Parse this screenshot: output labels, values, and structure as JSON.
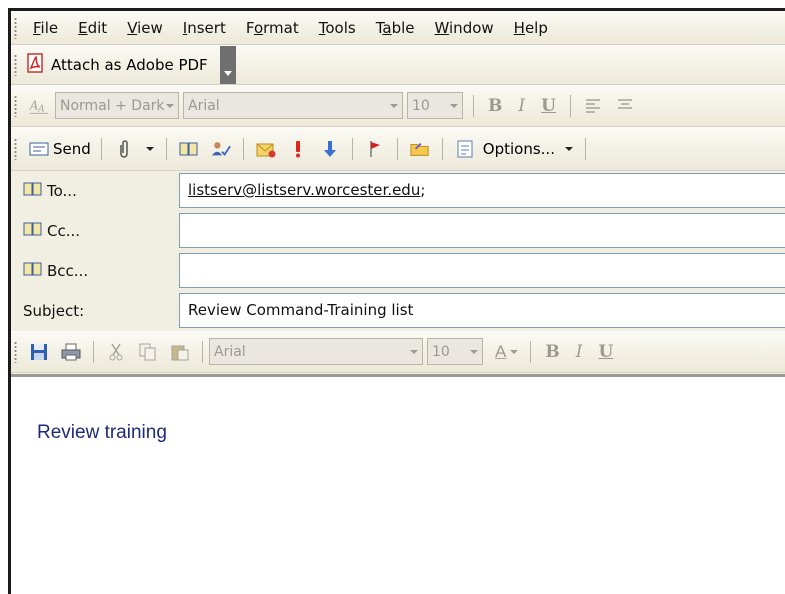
{
  "menu": {
    "items": [
      {
        "label": "File",
        "mnemonic_index": 0
      },
      {
        "label": "Edit",
        "mnemonic_index": 0
      },
      {
        "label": "View",
        "mnemonic_index": 0
      },
      {
        "label": "Insert",
        "mnemonic_index": 0
      },
      {
        "label": "Format",
        "mnemonic_index": 1
      },
      {
        "label": "Tools",
        "mnemonic_index": 0
      },
      {
        "label": "Table",
        "mnemonic_index": 1
      },
      {
        "label": "Window",
        "mnemonic_index": 0
      },
      {
        "label": "Help",
        "mnemonic_index": 0
      }
    ]
  },
  "pdf_toolbar": {
    "attach_label": "Attach as Adobe PDF",
    "icon": "adobe-pdf-icon"
  },
  "format_toolbar": {
    "style_value": "Normal + Dark",
    "font_value": "Arial",
    "size_value": "10",
    "bold": "B",
    "italic": "I",
    "underline": "U"
  },
  "send_toolbar": {
    "send_label": "Send",
    "options_label": "Options..."
  },
  "fields": {
    "to_label": "To...",
    "to_value": "listserv@listserv.worcester.edu",
    "to_suffix": ";",
    "cc_label": "Cc...",
    "cc_value": "",
    "bcc_label": "Bcc...",
    "bcc_value": "",
    "subject_label": "Subject:",
    "subject_value": "Review Command-Training list"
  },
  "body_toolbar": {
    "font_value": "Arial",
    "size_value": "10",
    "font_color_glyph": "A",
    "bold": "B",
    "italic": "I",
    "underline": "U"
  },
  "body": {
    "text": "Review training"
  },
  "colors": {
    "toolbar_bg": "#ece9d8",
    "body_text": "#1f2a7a",
    "input_border": "#7f9db9"
  }
}
